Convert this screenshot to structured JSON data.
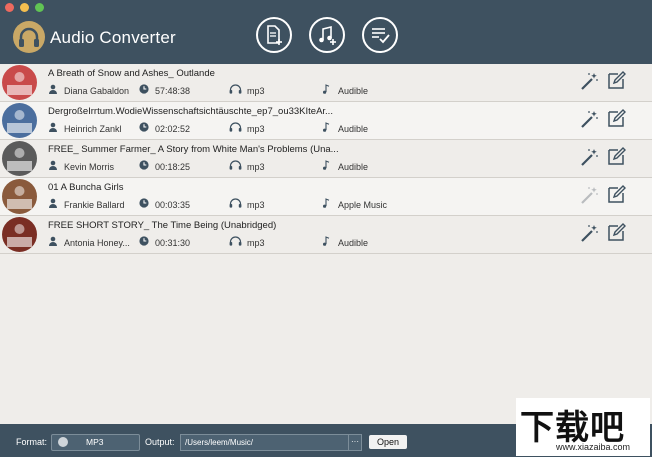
{
  "window": {
    "title": "Audio Converter"
  },
  "toolbar": {
    "add_files": "add-file-icon",
    "add_music": "add-music-icon",
    "convert_list": "checklist-icon"
  },
  "tracks": [
    {
      "title": "A Breath of Snow and Ashes_ Outlande",
      "author": "Diana Gabaldon",
      "duration": "57:48:38",
      "format": "mp3",
      "source": "Audible",
      "cover": "#c94a4a"
    },
    {
      "title": "DergroßeIrrtum.WodieWissenschaftsichtäuschte_ep7_ou33KIteAr...",
      "author": "Heinrich Zankl",
      "duration": "02:02:52",
      "format": "mp3",
      "source": "Audible",
      "cover": "#4b6e9e"
    },
    {
      "title": "FREE_ Summer Farmer_ A Story from White Man's Problems (Una...",
      "author": "Kevin Morris",
      "duration": "00:18:25",
      "format": "mp3",
      "source": "Audible",
      "cover": "#5b5b5b"
    },
    {
      "title": "01 A Buncha Girls",
      "author": "Frankie Ballard",
      "duration": "00:03:35",
      "format": "mp3",
      "source": "Apple Music",
      "cover": "#8a5a3c"
    },
    {
      "title": "FREE SHORT STORY_ The Time Being (Unabridged)",
      "author": "Antonia Honey...",
      "duration": "00:31:30",
      "format": "mp3",
      "source": "Audible",
      "cover": "#7a2e24"
    }
  ],
  "footer": {
    "format_label": "Format:",
    "format_value": "MP3",
    "output_label": "Output:",
    "output_path": "/Users/leem/Music/",
    "browse_label": "···",
    "open_label": "Open"
  },
  "watermark": {
    "big": "下载吧",
    "small": "www.xiazaiba.com"
  },
  "colors": {
    "header": "#3e5160",
    "row_bg": "#efedea",
    "accent": "#c9a866"
  }
}
